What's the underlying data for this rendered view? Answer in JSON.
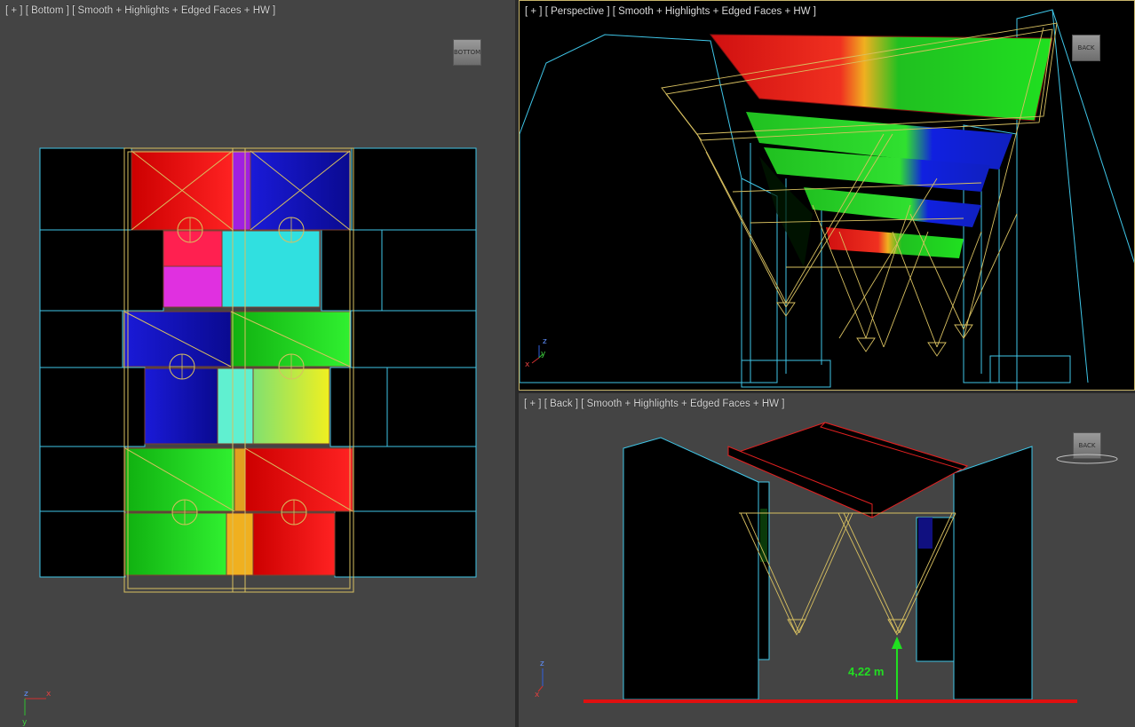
{
  "viewports": {
    "bottom": {
      "label": "[ + ] [ Bottom ] [ Smooth + Highlights + Edged Faces + HW ]",
      "viewcube": "BOTTOM"
    },
    "perspective": {
      "label": "[ + ] [ Perspective ] [ Smooth + Highlights + Edged Faces + HW ]",
      "viewcube": "BACK"
    },
    "back": {
      "label": "[ + ] [ Back ] [ Smooth + Highlights + Edged Faces + HW ]",
      "viewcube": "BACK"
    }
  },
  "measurement": "4,22 m",
  "axes": {
    "x": "x",
    "y": "y",
    "z": "z"
  },
  "colors": {
    "viewport_bg": "#444444",
    "edge_cyan": "#3fc6e8",
    "light_yellow": "#d8c060",
    "ground_red": "#e01010"
  }
}
